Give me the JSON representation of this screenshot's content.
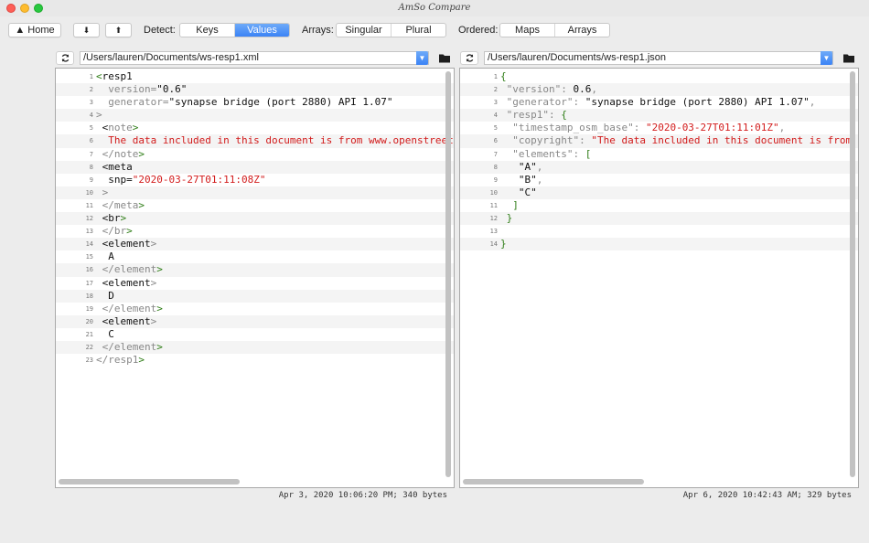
{
  "window": {
    "title": "AmSo Compare"
  },
  "toolbar": {
    "home_label": "▲ Home",
    "down_label": "⬇",
    "up_label": "⬆",
    "detect_label": "Detect:",
    "detect_options": [
      "Keys",
      "Values"
    ],
    "detect_selected": "Values",
    "arrays_label": "Arrays:",
    "arrays_options": [
      "Singular",
      "Plural"
    ],
    "ordered_label": "Ordered:",
    "ordered_options": [
      "Maps",
      "Arrays"
    ]
  },
  "left": {
    "path": "/Users/lauren/Documents/ws-resp1.xml",
    "status": "Apr 3, 2020 10:06:20 PM; 340 bytes",
    "lines": [
      {
        "n": "1",
        "parts": [
          [
            "tag",
            "<"
          ],
          [
            "txt",
            "resp1"
          ]
        ]
      },
      {
        "n": "2",
        "parts": [
          [
            "attr",
            "  version="
          ],
          [
            "txt",
            "\"0.6\""
          ]
        ]
      },
      {
        "n": "3",
        "parts": [
          [
            "attr",
            "  generator="
          ],
          [
            "txt",
            "\"synapse bridge (port 2880) API 1.07\""
          ]
        ]
      },
      {
        "n": "4",
        "parts": [
          [
            "attr",
            ">"
          ]
        ]
      },
      {
        "n": "5",
        "parts": [
          [
            "txt",
            " <"
          ],
          [
            "attr",
            "note"
          ],
          [
            "tag",
            ">"
          ]
        ]
      },
      {
        "n": "6",
        "parts": [
          [
            "str",
            "  The data included in this document is from www.openstreet"
          ]
        ]
      },
      {
        "n": "7",
        "parts": [
          [
            "attr",
            " </note"
          ],
          [
            "tag",
            ">"
          ]
        ]
      },
      {
        "n": "8",
        "parts": [
          [
            "txt",
            " <meta"
          ]
        ]
      },
      {
        "n": "9",
        "parts": [
          [
            "txt",
            "  snp="
          ],
          [
            "str",
            "\"2020-03-27T01:11:08Z\""
          ]
        ]
      },
      {
        "n": "10",
        "parts": [
          [
            "attr",
            " >"
          ]
        ]
      },
      {
        "n": "11",
        "parts": [
          [
            "attr",
            " </meta"
          ],
          [
            "tag",
            ">"
          ]
        ]
      },
      {
        "n": "12",
        "parts": [
          [
            "txt",
            " <br"
          ],
          [
            "tag",
            ">"
          ]
        ]
      },
      {
        "n": "13",
        "parts": [
          [
            "attr",
            " </br"
          ],
          [
            "tag",
            ">"
          ]
        ]
      },
      {
        "n": "14",
        "parts": [
          [
            "txt",
            " <element"
          ],
          [
            "attr",
            ">"
          ]
        ]
      },
      {
        "n": "15",
        "parts": [
          [
            "txt",
            "  A"
          ]
        ]
      },
      {
        "n": "16",
        "parts": [
          [
            "attr",
            " </element"
          ],
          [
            "tag",
            ">"
          ]
        ]
      },
      {
        "n": "17",
        "parts": [
          [
            "txt",
            " <element"
          ],
          [
            "attr",
            ">"
          ]
        ]
      },
      {
        "n": "18",
        "parts": [
          [
            "txt",
            "  D"
          ]
        ]
      },
      {
        "n": "19",
        "parts": [
          [
            "attr",
            " </element"
          ],
          [
            "tag",
            ">"
          ]
        ]
      },
      {
        "n": "20",
        "parts": [
          [
            "txt",
            " <element"
          ],
          [
            "attr",
            ">"
          ]
        ]
      },
      {
        "n": "21",
        "parts": [
          [
            "txt",
            "  C"
          ]
        ]
      },
      {
        "n": "22",
        "parts": [
          [
            "attr",
            " </element"
          ],
          [
            "tag",
            ">"
          ]
        ]
      },
      {
        "n": "23",
        "parts": [
          [
            "attr",
            "</resp1"
          ],
          [
            "tag",
            ">"
          ]
        ]
      }
    ]
  },
  "right": {
    "path": "/Users/lauren/Documents/ws-resp1.json",
    "status": "Apr 6, 2020 10:42:43 AM; 329 bytes",
    "lines": [
      {
        "n": "1",
        "parts": [
          [
            "tag",
            "{"
          ]
        ]
      },
      {
        "n": "2",
        "parts": [
          [
            "attr",
            " \"version\": "
          ],
          [
            "num",
            "0.6"
          ],
          [
            "attr",
            ","
          ]
        ]
      },
      {
        "n": "3",
        "parts": [
          [
            "attr",
            " \"generator\": "
          ],
          [
            "txt",
            "\"synapse bridge (port 2880) API 1.07\""
          ],
          [
            "attr",
            ","
          ]
        ]
      },
      {
        "n": "4",
        "parts": [
          [
            "attr",
            " \"resp1\": "
          ],
          [
            "tag",
            "{"
          ]
        ]
      },
      {
        "n": "5",
        "parts": [
          [
            "attr",
            "  \"timestamp_osm_base\": "
          ],
          [
            "str",
            "\"2020-03-27T01:11:01Z\""
          ],
          [
            "attr",
            ","
          ]
        ]
      },
      {
        "n": "6",
        "parts": [
          [
            "attr",
            "  \"copyright\": "
          ],
          [
            "str",
            "\"The data included in this document is from"
          ]
        ]
      },
      {
        "n": "7",
        "parts": [
          [
            "attr",
            "  \"elements\": "
          ],
          [
            "tag",
            "["
          ]
        ]
      },
      {
        "n": "8",
        "parts": [
          [
            "txt",
            "   \"A\""
          ],
          [
            "attr",
            ","
          ]
        ]
      },
      {
        "n": "9",
        "parts": [
          [
            "txt",
            "   \"B\""
          ],
          [
            "attr",
            ","
          ]
        ]
      },
      {
        "n": "10",
        "parts": [
          [
            "txt",
            "   \"C\""
          ]
        ]
      },
      {
        "n": "11",
        "parts": [
          [
            "tag",
            "  ]"
          ]
        ]
      },
      {
        "n": "12",
        "parts": [
          [
            "tag",
            " }"
          ]
        ]
      },
      {
        "n": "13",
        "parts": []
      },
      {
        "n": "14",
        "parts": [
          [
            "tag",
            "}"
          ]
        ]
      }
    ]
  }
}
